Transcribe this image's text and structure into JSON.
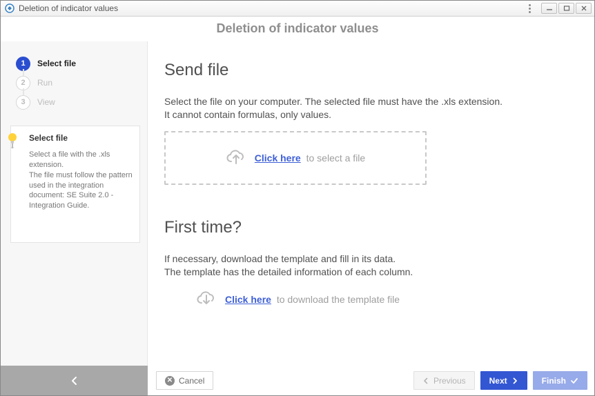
{
  "window": {
    "title": "Deletion of indicator values"
  },
  "page": {
    "title": "Deletion of indicator values"
  },
  "steps": [
    {
      "num": "1",
      "label": "Select file",
      "active": true
    },
    {
      "num": "2",
      "label": "Run",
      "active": false
    },
    {
      "num": "3",
      "label": "View",
      "active": false
    }
  ],
  "tip": {
    "title": "Select file",
    "body": "Select a file with the .xls extension.\nThe file must follow the pattern used in the integration document: SE Suite 2.0 - Integration Guide."
  },
  "send": {
    "heading": "Send file",
    "desc1": "Select the file on your computer. The selected file must have the .xls extension.",
    "desc2": "It cannot contain formulas, only values.",
    "click_here": "Click here",
    "suffix": " to select a file"
  },
  "first": {
    "heading": "First time?",
    "desc1": "If necessary, download the template and fill in its data.",
    "desc2": "The template has the detailed information of each column.",
    "click_here": "Click here",
    "suffix": " to download the template file"
  },
  "footer": {
    "cancel": "Cancel",
    "previous": "Previous",
    "next": "Next",
    "finish": "Finish"
  }
}
